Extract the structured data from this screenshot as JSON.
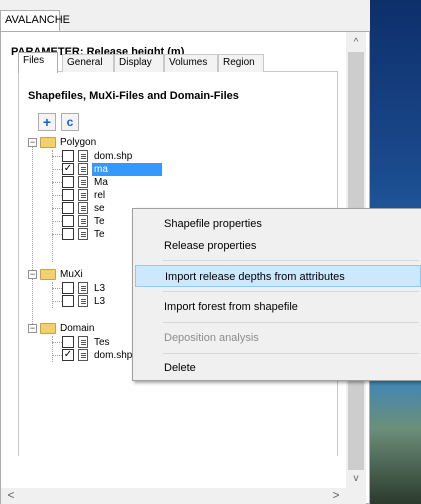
{
  "window_tab": "AVALANCHE",
  "parameter_title": "PARAMETER: Release height (m)",
  "tabs": [
    {
      "label": "Files",
      "active": true
    },
    {
      "label": "General",
      "active": false
    },
    {
      "label": "Display",
      "active": false
    },
    {
      "label": "Volumes",
      "active": false
    },
    {
      "label": "Region",
      "active": false
    }
  ],
  "section_title": "Shapefiles, MuXi-Files and Domain-Files",
  "toolbar": {
    "add_symbol": "+",
    "refresh_symbol": "c"
  },
  "tree": {
    "polygon": {
      "label": "Polygon",
      "items": [
        {
          "label": "dom.shp",
          "checked": false
        },
        {
          "label": "ma",
          "checked": true,
          "selected": true
        },
        {
          "label": "Ma",
          "checked": false
        },
        {
          "label": "rel",
          "checked": false
        },
        {
          "label": "se",
          "checked": false
        },
        {
          "label": "Te",
          "checked": false
        },
        {
          "label": "Te",
          "checked": false
        }
      ]
    },
    "muxi": {
      "label": "MuXi",
      "items": [
        {
          "label": "L3",
          "checked": false
        },
        {
          "label": "L3",
          "checked": false
        }
      ]
    },
    "domain": {
      "label": "Domain",
      "items": [
        {
          "label": "Tes",
          "checked": false
        },
        {
          "label": "dom.shp (input)",
          "checked": true
        }
      ]
    }
  },
  "context_menu": {
    "items": [
      {
        "label": "Shapefile properties",
        "disabled": false,
        "hover": false
      },
      {
        "label": "Release properties",
        "disabled": false,
        "hover": false
      },
      {
        "label": "Import release depths from attributes",
        "disabled": false,
        "hover": true
      },
      {
        "label": "Import forest from shapefile",
        "disabled": false,
        "hover": false
      },
      {
        "label": "Deposition analysis",
        "disabled": true,
        "hover": false
      },
      {
        "label": "Delete",
        "disabled": false,
        "hover": false
      }
    ]
  },
  "scrollbar": {
    "up_arrow": "^",
    "down_arrow": "v",
    "left_arrow": "<",
    "right_arrow": ">"
  },
  "colors": {
    "selection": "#3399ff",
    "menu_hover": "#cce8ff",
    "toolbar_icon": "#1a5fc9"
  }
}
